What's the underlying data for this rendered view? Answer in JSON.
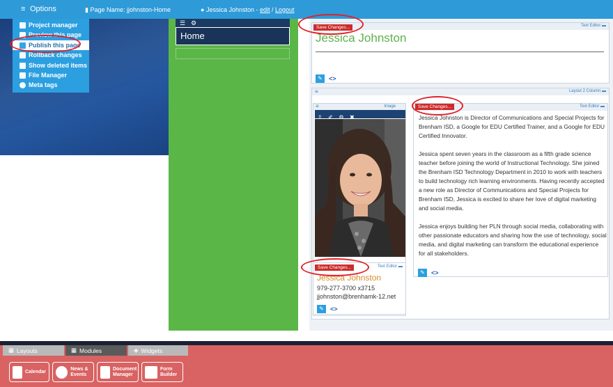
{
  "topbar": {
    "options_label": "Options",
    "page_name": "Page Name: jjohnston-Home",
    "user_name": "Jessica Johnston - ",
    "edit_label": "edit",
    "separator": " / ",
    "logout_label": "Logout"
  },
  "options_menu": {
    "items": [
      {
        "label": "Project manager",
        "icon": "sitemap-icon"
      },
      {
        "label": "Preview this page",
        "icon": "page-icon"
      },
      {
        "label": "Publish this page",
        "icon": "page-icon"
      },
      {
        "label": "Rollback changes",
        "icon": "back-arrow-icon"
      },
      {
        "label": "Show deleted items",
        "icon": "trash-icon"
      },
      {
        "label": "File Manager",
        "icon": "sitemap-icon"
      },
      {
        "label": "Meta tags",
        "icon": "gear-icon"
      }
    ]
  },
  "nav_module": {
    "home_label": "Home"
  },
  "module1": {
    "save_label": "Save Changes...",
    "type_label": "Text Editor",
    "heading": "Jessica Johnston"
  },
  "module2": {
    "type_label": "Layout 2 Column",
    "image_label": "Image",
    "text_save_label": "Save Changes...",
    "text_type_label": "Text Editor",
    "bio_paragraphs": [
      "Jessica Johnston is Director of Communications and Special Projects for Brenham ISD, a Google for EDU Certified Trainer, and a Google for EDU Certified Innovator.",
      "Jessica spent seven years in the classroom as a fifth grade science teacher before joining the world of Instructional Technology. She joined the Brenham ISD Technology Department in 2010 to work with teachers to build technology rich learning environments. Having recently accepted a new role as Director of Communications and Special Projects for Brenham ISD, Jessica is excited to share her love of digital marketing and social media.",
      "Jessica enjoys building her PLN through social media, collaborating with other passionate educators and sharing how the use of technology, social media, and digital marketing can transform the educational experience for all stakeholders."
    ],
    "contact": {
      "save_label": "Save Changes...",
      "type_label": "Text Editor",
      "name": "Jessica Johnston",
      "phone": "979-277-3700 x3715",
      "email": "jjohnston@brenhamk-12.net"
    }
  },
  "bottom": {
    "tabs": [
      {
        "label": "Layouts",
        "state": "inactive"
      },
      {
        "label": "Modules",
        "state": "active"
      },
      {
        "label": "Widgets",
        "state": "inactive"
      }
    ],
    "modules": [
      {
        "label": "Calendar"
      },
      {
        "label": "News & Events"
      },
      {
        "label": "Document Manager"
      },
      {
        "label": "Form Builder"
      }
    ]
  },
  "colors": {
    "topbar": "#2e9ad8",
    "green_column": "#5bb648",
    "save_button": "#cc2b2b",
    "tray": "#d96262",
    "annotation": "#e0212a"
  }
}
